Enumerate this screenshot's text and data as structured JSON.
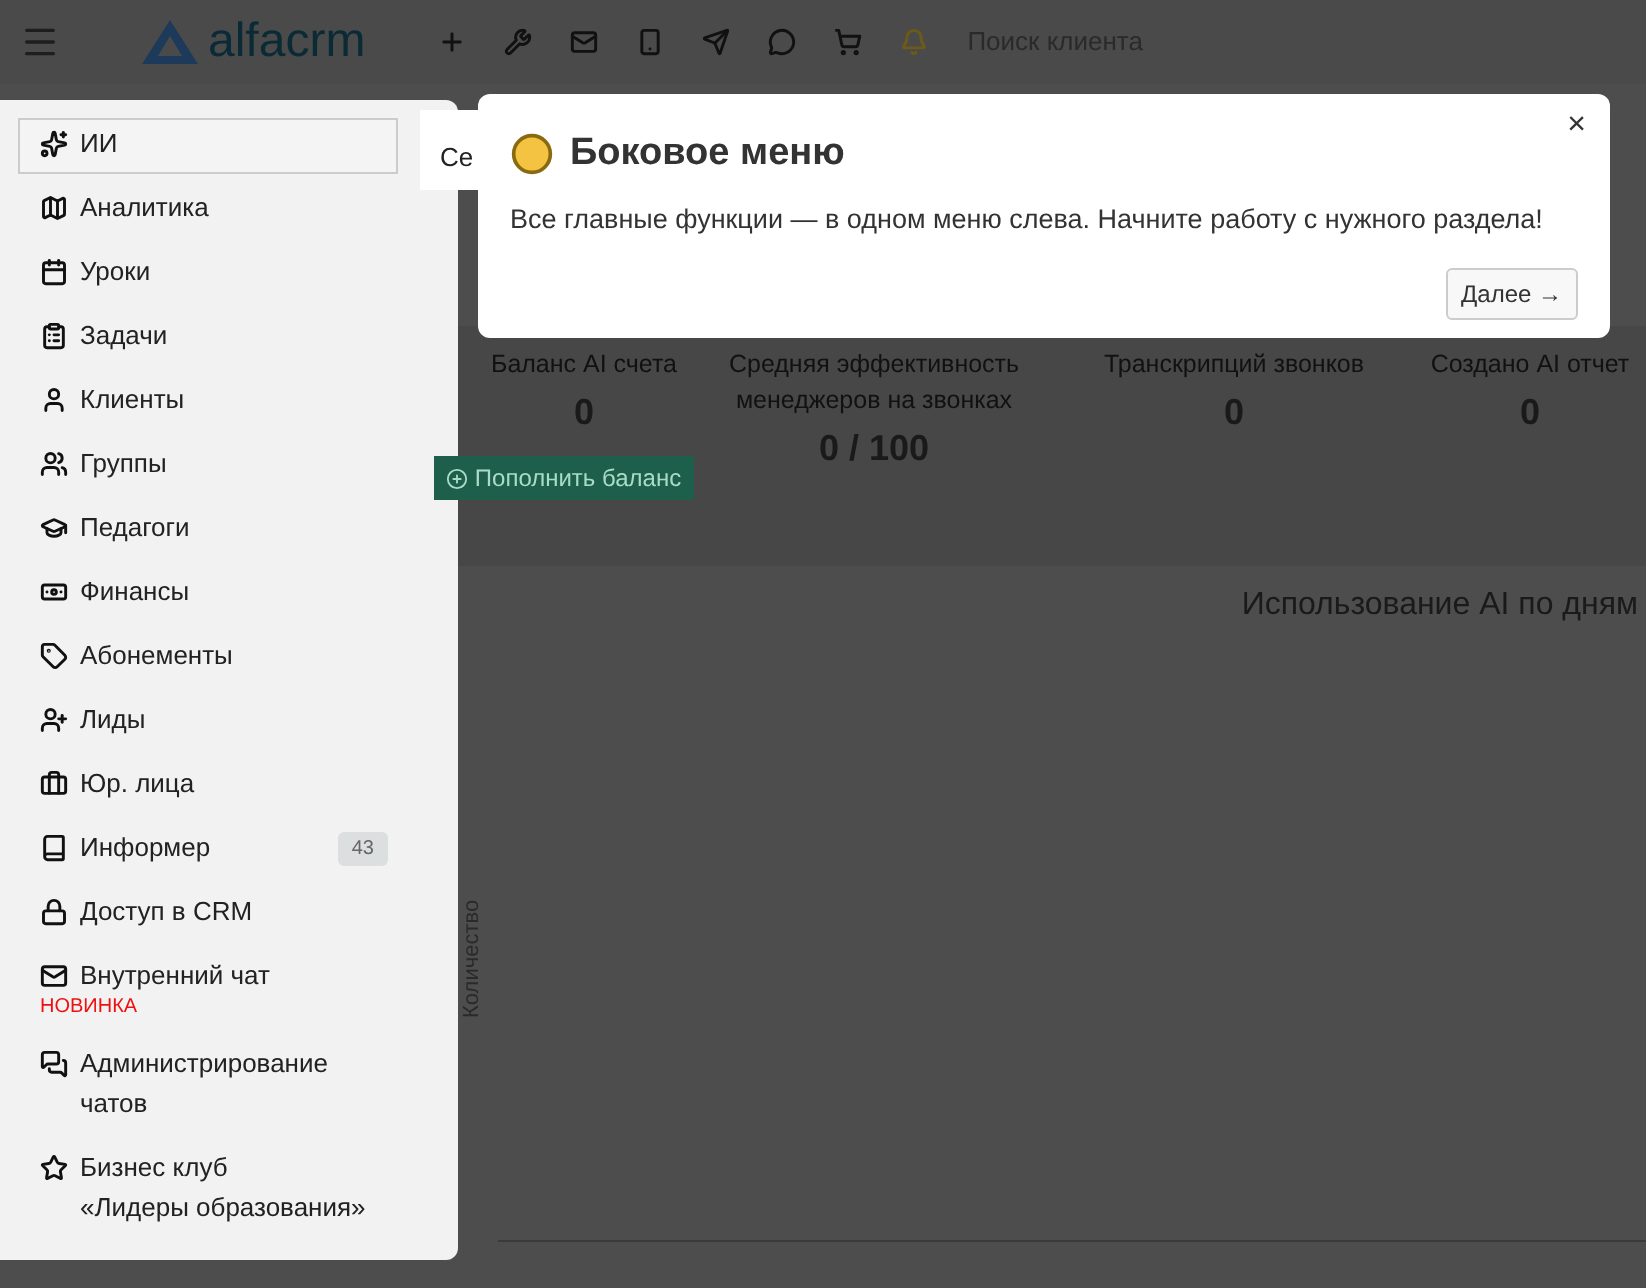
{
  "topbar": {
    "logo": "alfacrm",
    "actions": [
      {
        "kind": "plus"
      },
      {
        "kind": "wrench"
      },
      {
        "kind": "mail"
      },
      {
        "kind": "phone"
      },
      {
        "kind": "telegram"
      },
      {
        "kind": "chat"
      },
      {
        "kind": "cart"
      },
      {
        "kind": "bell"
      }
    ],
    "search": {
      "placeholder": "Поиск клиента"
    }
  },
  "sidebar": {
    "items": [
      {
        "kind": "ai",
        "label": "ИИ",
        "selected": true
      },
      {
        "kind": "map",
        "label": "Аналитика",
        "selected": false
      },
      {
        "kind": "calendar",
        "label": "Уроки",
        "selected": false
      },
      {
        "kind": "clipboard",
        "label": "Задачи",
        "selected": false
      },
      {
        "kind": "user",
        "label": "Клиенты",
        "selected": false
      },
      {
        "kind": "users",
        "label": "Группы",
        "selected": false
      },
      {
        "kind": "cap",
        "label": "Педагоги",
        "selected": false
      },
      {
        "kind": "money",
        "label": "Финансы",
        "selected": false
      },
      {
        "kind": "tag",
        "label": "Абонементы",
        "selected": false
      },
      {
        "kind": "userplus",
        "label": "Лиды",
        "selected": false
      },
      {
        "kind": "briefcase",
        "label": "Юр. лица",
        "selected": false
      },
      {
        "kind": "book",
        "label": "Информер",
        "selected": false,
        "badge": "43"
      },
      {
        "kind": "lock",
        "label": "Доступ в CRM",
        "selected": false
      },
      {
        "kind": "mail",
        "label": "Внутренний чат",
        "selected": false,
        "note": "НОВИНКА"
      },
      {
        "kind": "chats",
        "label": "Администрирование\nчатов",
        "selected": false
      },
      {
        "kind": "star",
        "label": "Бизнес клуб\n«Лидеры образования»",
        "selected": false
      }
    ]
  },
  "main": {
    "tab_fragment": "Се",
    "stats": [
      {
        "label": "Баланс AI счета",
        "value": "0",
        "button": "Пополнить баланс"
      },
      {
        "label": "Средняя эффективность менеджеров на звонках",
        "value": "0 / 100"
      },
      {
        "label": "Транскрипций звонков",
        "value": "0"
      },
      {
        "label": "Создано AI отчет",
        "value": "0"
      }
    ],
    "chart": {
      "title": "Использование AI по дням",
      "ylabel": "Количество"
    }
  },
  "popover": {
    "title": "Боковое меню",
    "text": "Все главные функции — в одном меню слева. Начните работу с нужного раздела!",
    "close": "×",
    "next_button": "Далее →"
  }
}
